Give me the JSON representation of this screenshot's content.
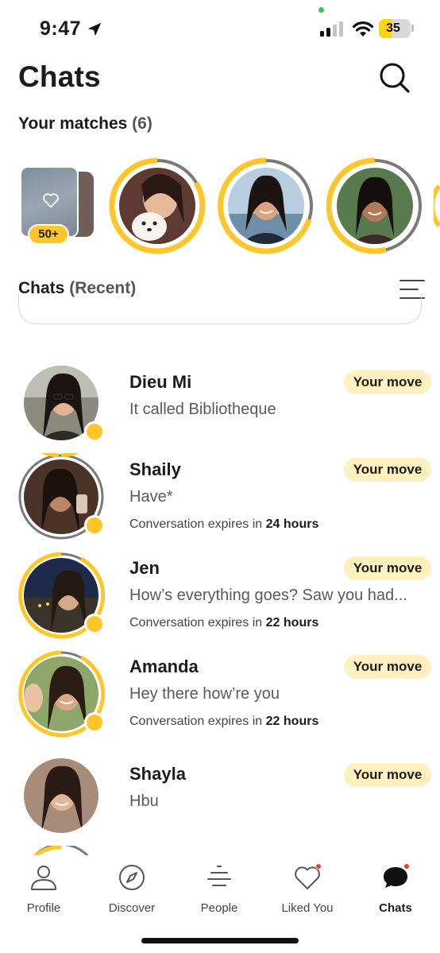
{
  "status_bar": {
    "time": "9:47",
    "battery": "35"
  },
  "header": {
    "title": "Chats"
  },
  "matches": {
    "label": "Your matches",
    "count": "(6)",
    "likes_badge": "50+",
    "matches_shown": 3
  },
  "chats": {
    "label": "Chats",
    "sub_label": "(Recent)",
    "items": [
      {
        "name": "Dieu Mi",
        "message": "It called Bibliotheque",
        "expire_prefix": "",
        "expire_value": "",
        "badge": "Your move"
      },
      {
        "name": "Shaily",
        "message": "Have*",
        "expire_prefix": "Conversation expires in",
        "expire_value": "24 hours",
        "badge": "Your move"
      },
      {
        "name": "Jen",
        "message": "How’s everything goes? Saw you had...",
        "expire_prefix": "Conversation expires in",
        "expire_value": "22 hours",
        "badge": "Your move"
      },
      {
        "name": "Amanda",
        "message": "Hey there how’re you",
        "expire_prefix": "Conversation expires in",
        "expire_value": "22 hours",
        "badge": "Your move"
      },
      {
        "name": "Shayla",
        "message": "Hbu",
        "expire_prefix": "",
        "expire_value": "",
        "badge": "Your move"
      }
    ]
  },
  "tabs": [
    {
      "label": "Profile",
      "icon": "person-icon"
    },
    {
      "label": "Discover",
      "icon": "compass-icon"
    },
    {
      "label": "People",
      "icon": "people-filter-icon"
    },
    {
      "label": "Liked You",
      "icon": "heart-icon"
    },
    {
      "label": "Chats",
      "icon": "chat-bubble-icon"
    }
  ],
  "colors": {
    "accent": "#ffc629",
    "badge_bg": "#fff1bf",
    "notification": "#e0442b"
  }
}
